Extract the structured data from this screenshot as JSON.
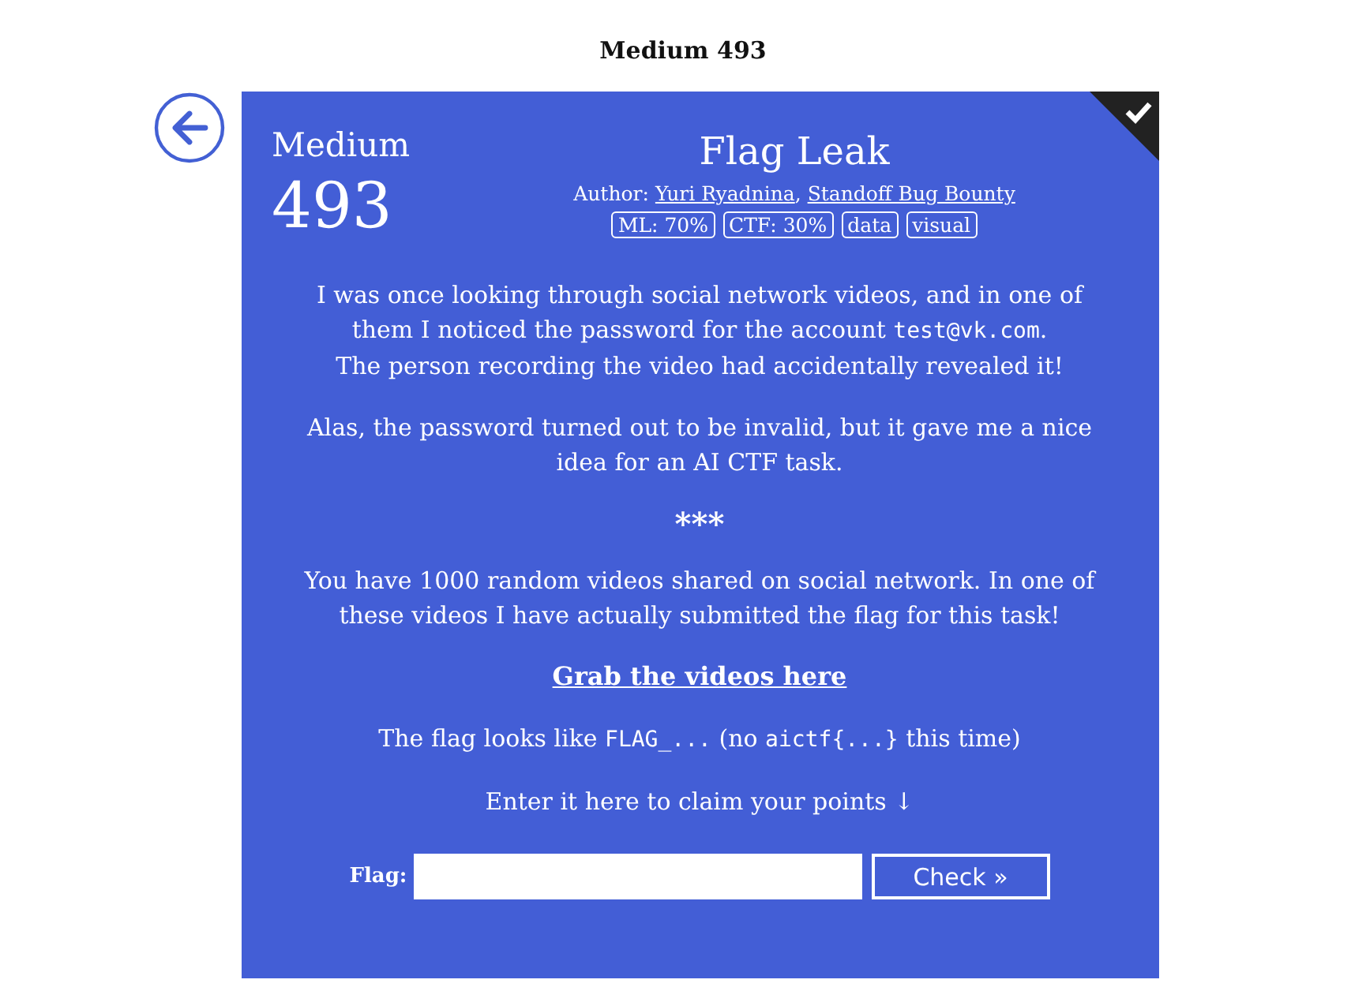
{
  "page_title": "Medium 493",
  "task": {
    "solved": true,
    "difficulty": "Medium",
    "points": "493",
    "title": "Flag Leak",
    "byline": [
      {
        "kind": "text",
        "text": "Author: "
      },
      {
        "kind": "link",
        "text": "Yuri Ryadnina"
      },
      {
        "kind": "text",
        "text": ", "
      },
      {
        "kind": "link",
        "text": "Standoff Bug Bounty"
      }
    ],
    "tags": [
      "ML: 70%",
      "CTF: 30%",
      "data",
      "visual"
    ],
    "description": [
      [
        {
          "kind": "text",
          "text": "I was once looking through social network videos, and in one of them I noticed the password for the account "
        },
        {
          "kind": "code",
          "text": "test@vk.com"
        },
        {
          "kind": "text",
          "text": "."
        },
        {
          "kind": "break"
        },
        {
          "kind": "text",
          "text": "The person recording the video had accidentally revealed it!"
        }
      ],
      [
        {
          "kind": "text",
          "text": "Alas, the password turned out to be invalid, but it gave me a nice idea for an AI CTF task."
        }
      ]
    ],
    "separator": "***",
    "task_text": [
      {
        "kind": "text",
        "text": "You have 1000 random videos shared on social network. In one of these videos I have actually submitted the flag for this task!"
      }
    ],
    "download_link": "Grab the videos here",
    "flag_hint": [
      {
        "kind": "text",
        "text": "The flag looks like "
      },
      {
        "kind": "code",
        "text": "FLAG_..."
      },
      {
        "kind": "text",
        "text": " (no "
      },
      {
        "kind": "code",
        "text": "aictf{...}"
      },
      {
        "kind": "text",
        "text": " this time)"
      }
    ],
    "claim_text": "Enter it here to claim your points ↓",
    "flag_form": {
      "label": "Flag:",
      "button": "Check »"
    }
  }
}
